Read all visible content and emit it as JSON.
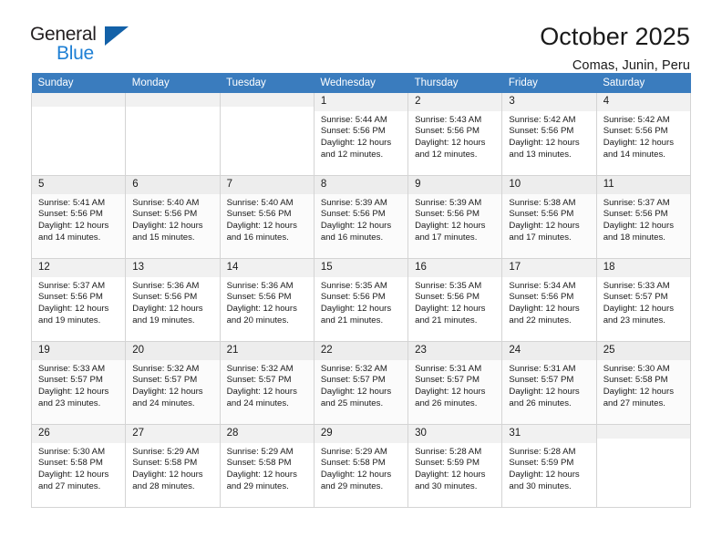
{
  "brand": {
    "name_top": "General",
    "name_bottom": "Blue",
    "triangle_color": "#1361a8",
    "blue_color": "#1e7fd4"
  },
  "header": {
    "title": "October 2025",
    "subtitle": "Comas, Junin, Peru"
  },
  "theme": {
    "header_row_bg": "#3a7cbe",
    "header_row_text": "#ffffff",
    "daynum_bg": "#f1f1f1",
    "grid_border": "#d4d4d4"
  },
  "weekdays": [
    "Sunday",
    "Monday",
    "Tuesday",
    "Wednesday",
    "Thursday",
    "Friday",
    "Saturday"
  ],
  "labels": {
    "sunrise_prefix": "Sunrise:",
    "sunset_prefix": "Sunset:",
    "daylight_prefix": "Daylight:"
  },
  "weeks": [
    [
      {
        "day": "",
        "empty": true
      },
      {
        "day": "",
        "empty": true
      },
      {
        "day": "",
        "empty": true
      },
      {
        "day": "1",
        "sunrise": "Sunrise: 5:44 AM",
        "sunset": "Sunset: 5:56 PM",
        "daylight": "Daylight: 12 hours and 12 minutes."
      },
      {
        "day": "2",
        "sunrise": "Sunrise: 5:43 AM",
        "sunset": "Sunset: 5:56 PM",
        "daylight": "Daylight: 12 hours and 12 minutes."
      },
      {
        "day": "3",
        "sunrise": "Sunrise: 5:42 AM",
        "sunset": "Sunset: 5:56 PM",
        "daylight": "Daylight: 12 hours and 13 minutes."
      },
      {
        "day": "4",
        "sunrise": "Sunrise: 5:42 AM",
        "sunset": "Sunset: 5:56 PM",
        "daylight": "Daylight: 12 hours and 14 minutes."
      }
    ],
    [
      {
        "day": "5",
        "sunrise": "Sunrise: 5:41 AM",
        "sunset": "Sunset: 5:56 PM",
        "daylight": "Daylight: 12 hours and 14 minutes."
      },
      {
        "day": "6",
        "sunrise": "Sunrise: 5:40 AM",
        "sunset": "Sunset: 5:56 PM",
        "daylight": "Daylight: 12 hours and 15 minutes."
      },
      {
        "day": "7",
        "sunrise": "Sunrise: 5:40 AM",
        "sunset": "Sunset: 5:56 PM",
        "daylight": "Daylight: 12 hours and 16 minutes."
      },
      {
        "day": "8",
        "sunrise": "Sunrise: 5:39 AM",
        "sunset": "Sunset: 5:56 PM",
        "daylight": "Daylight: 12 hours and 16 minutes."
      },
      {
        "day": "9",
        "sunrise": "Sunrise: 5:39 AM",
        "sunset": "Sunset: 5:56 PM",
        "daylight": "Daylight: 12 hours and 17 minutes."
      },
      {
        "day": "10",
        "sunrise": "Sunrise: 5:38 AM",
        "sunset": "Sunset: 5:56 PM",
        "daylight": "Daylight: 12 hours and 17 minutes."
      },
      {
        "day": "11",
        "sunrise": "Sunrise: 5:37 AM",
        "sunset": "Sunset: 5:56 PM",
        "daylight": "Daylight: 12 hours and 18 minutes."
      }
    ],
    [
      {
        "day": "12",
        "sunrise": "Sunrise: 5:37 AM",
        "sunset": "Sunset: 5:56 PM",
        "daylight": "Daylight: 12 hours and 19 minutes."
      },
      {
        "day": "13",
        "sunrise": "Sunrise: 5:36 AM",
        "sunset": "Sunset: 5:56 PM",
        "daylight": "Daylight: 12 hours and 19 minutes."
      },
      {
        "day": "14",
        "sunrise": "Sunrise: 5:36 AM",
        "sunset": "Sunset: 5:56 PM",
        "daylight": "Daylight: 12 hours and 20 minutes."
      },
      {
        "day": "15",
        "sunrise": "Sunrise: 5:35 AM",
        "sunset": "Sunset: 5:56 PM",
        "daylight": "Daylight: 12 hours and 21 minutes."
      },
      {
        "day": "16",
        "sunrise": "Sunrise: 5:35 AM",
        "sunset": "Sunset: 5:56 PM",
        "daylight": "Daylight: 12 hours and 21 minutes."
      },
      {
        "day": "17",
        "sunrise": "Sunrise: 5:34 AM",
        "sunset": "Sunset: 5:56 PM",
        "daylight": "Daylight: 12 hours and 22 minutes."
      },
      {
        "day": "18",
        "sunrise": "Sunrise: 5:33 AM",
        "sunset": "Sunset: 5:57 PM",
        "daylight": "Daylight: 12 hours and 23 minutes."
      }
    ],
    [
      {
        "day": "19",
        "sunrise": "Sunrise: 5:33 AM",
        "sunset": "Sunset: 5:57 PM",
        "daylight": "Daylight: 12 hours and 23 minutes."
      },
      {
        "day": "20",
        "sunrise": "Sunrise: 5:32 AM",
        "sunset": "Sunset: 5:57 PM",
        "daylight": "Daylight: 12 hours and 24 minutes."
      },
      {
        "day": "21",
        "sunrise": "Sunrise: 5:32 AM",
        "sunset": "Sunset: 5:57 PM",
        "daylight": "Daylight: 12 hours and 24 minutes."
      },
      {
        "day": "22",
        "sunrise": "Sunrise: 5:32 AM",
        "sunset": "Sunset: 5:57 PM",
        "daylight": "Daylight: 12 hours and 25 minutes."
      },
      {
        "day": "23",
        "sunrise": "Sunrise: 5:31 AM",
        "sunset": "Sunset: 5:57 PM",
        "daylight": "Daylight: 12 hours and 26 minutes."
      },
      {
        "day": "24",
        "sunrise": "Sunrise: 5:31 AM",
        "sunset": "Sunset: 5:57 PM",
        "daylight": "Daylight: 12 hours and 26 minutes."
      },
      {
        "day": "25",
        "sunrise": "Sunrise: 5:30 AM",
        "sunset": "Sunset: 5:58 PM",
        "daylight": "Daylight: 12 hours and 27 minutes."
      }
    ],
    [
      {
        "day": "26",
        "sunrise": "Sunrise: 5:30 AM",
        "sunset": "Sunset: 5:58 PM",
        "daylight": "Daylight: 12 hours and 27 minutes."
      },
      {
        "day": "27",
        "sunrise": "Sunrise: 5:29 AM",
        "sunset": "Sunset: 5:58 PM",
        "daylight": "Daylight: 12 hours and 28 minutes."
      },
      {
        "day": "28",
        "sunrise": "Sunrise: 5:29 AM",
        "sunset": "Sunset: 5:58 PM",
        "daylight": "Daylight: 12 hours and 29 minutes."
      },
      {
        "day": "29",
        "sunrise": "Sunrise: 5:29 AM",
        "sunset": "Sunset: 5:58 PM",
        "daylight": "Daylight: 12 hours and 29 minutes."
      },
      {
        "day": "30",
        "sunrise": "Sunrise: 5:28 AM",
        "sunset": "Sunset: 5:59 PM",
        "daylight": "Daylight: 12 hours and 30 minutes."
      },
      {
        "day": "31",
        "sunrise": "Sunrise: 5:28 AM",
        "sunset": "Sunset: 5:59 PM",
        "daylight": "Daylight: 12 hours and 30 minutes."
      },
      {
        "day": "",
        "empty": true
      }
    ]
  ]
}
